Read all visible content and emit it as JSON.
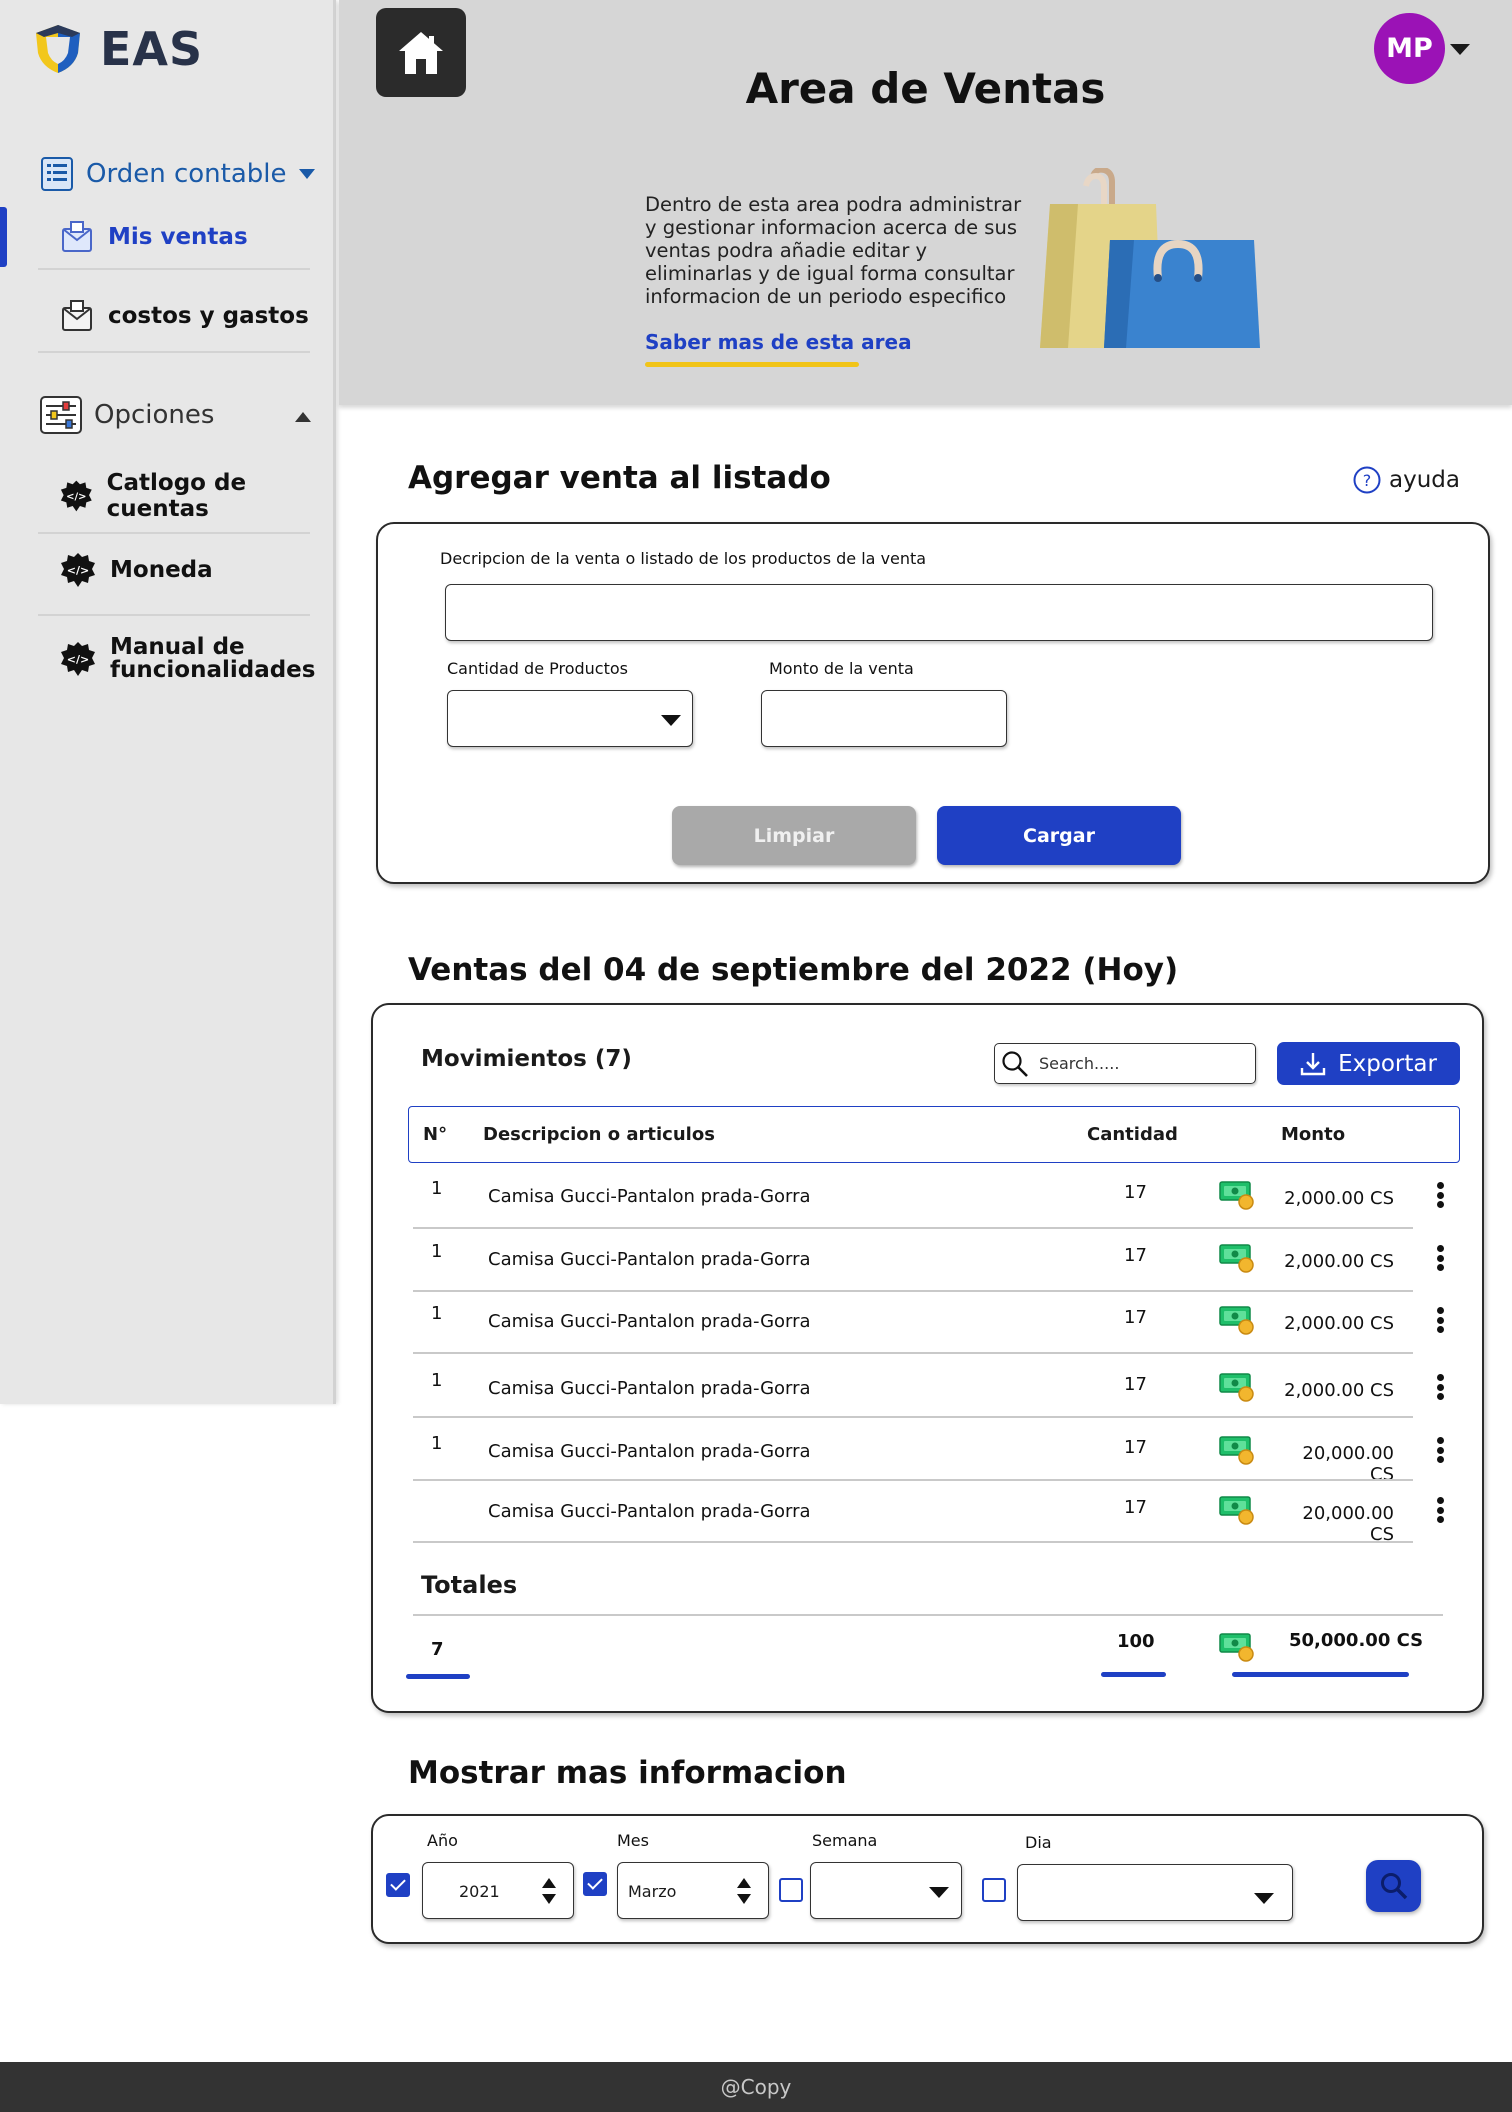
{
  "brand": {
    "name": "EAS"
  },
  "sidebar": {
    "group1": {
      "label": "Orden contable",
      "color": "#1a5aa8"
    },
    "items1": [
      {
        "label": "Mis ventas",
        "active": true
      },
      {
        "label": "costos y gastos",
        "active": false
      }
    ],
    "group2": {
      "label": "Opciones"
    },
    "items2": [
      {
        "label": "Catlogo de cuentas"
      },
      {
        "label": "Moneda"
      },
      {
        "label": "Manual de funcionalidades"
      }
    ]
  },
  "header": {
    "title": "Area de Ventas",
    "avatar_initials": "MP",
    "avatar_color": "#9b12b6",
    "intro": "Dentro de esta area podra administrar y gestionar informacion acerca de sus ventas podra añadie editar y eliminarlas y de igual forma consultar informacion de un periodo especifico",
    "learn_more": "Saber mas de esta area"
  },
  "add_sale": {
    "title": "Agregar venta al listado",
    "help_label": "ayuda",
    "description_label": "Decripcion de la venta o listado de los productos de la venta",
    "description_value": "",
    "quantity_label": "Cantidad de Productos",
    "quantity_value": "",
    "amount_label": "Monto de la venta",
    "amount_value": "",
    "clear_button": "Limpiar",
    "load_button": "Cargar"
  },
  "sales": {
    "title": "Ventas del 04 de septiembre del 2022 (Hoy)",
    "movements_label": "Movimientos (7)",
    "search_placeholder": "Search.....",
    "export_label": "Exportar",
    "columns": {
      "no": "N°",
      "description": "Descripcion o articulos",
      "quantity": "Cantidad",
      "amount": "Monto"
    },
    "rows": [
      {
        "no": "1",
        "description": "Camisa Gucci-Pantalon prada-Gorra",
        "quantity": "17",
        "amount": "2,000.00 CS"
      },
      {
        "no": "1",
        "description": "Camisa Gucci-Pantalon prada-Gorra",
        "quantity": "17",
        "amount": "2,000.00 CS"
      },
      {
        "no": "1",
        "description": "Camisa Gucci-Pantalon prada-Gorra",
        "quantity": "17",
        "amount": "2,000.00 CS"
      },
      {
        "no": "1",
        "description": "Camisa Gucci-Pantalon prada-Gorra",
        "quantity": "17",
        "amount": "2,000.00 CS"
      },
      {
        "no": "1",
        "description": "Camisa Gucci-Pantalon prada-Gorra",
        "quantity": "17",
        "amount": "20,000.00 CS"
      },
      {
        "no": "",
        "description": "Camisa Gucci-Pantalon prada-Gorra",
        "quantity": "17",
        "amount": "20,000.00 CS"
      }
    ],
    "totals_label": "Totales",
    "totals": {
      "count": "7",
      "quantity": "100",
      "amount": "50,000.00 CS"
    }
  },
  "more_info": {
    "title": "Mostrar mas informacion",
    "year": {
      "label": "Año",
      "value": "2021",
      "checked": true
    },
    "month": {
      "label": "Mes",
      "value": "Marzo",
      "checked": true
    },
    "week": {
      "label": "Semana",
      "value": "",
      "checked": false
    },
    "day": {
      "label": "Dia",
      "value": "",
      "checked": false
    }
  },
  "footer": {
    "text": "@Copy"
  },
  "colors": {
    "primary": "#1f40c4",
    "accent": "#f1c418",
    "sidebar_bg": "#e7e7e7",
    "header_bg": "#d6d6d6",
    "disabled": "#a9a9a9"
  }
}
